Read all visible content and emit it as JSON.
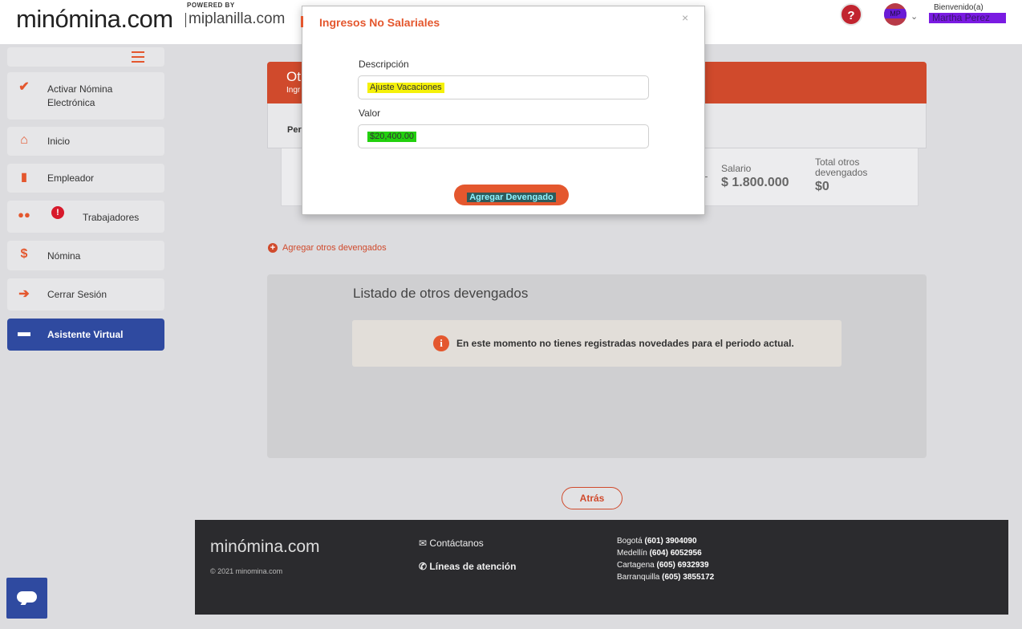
{
  "header": {
    "logo_text": "minómina.com",
    "powered_by": "POWERED BY",
    "partner": "miplanilla.com",
    "avatar_initials": "MP",
    "welcome": "Bienvenido(a)",
    "username": "Martha Perez"
  },
  "sidebar": {
    "items": [
      {
        "label": "Activar Nómina Electrónica"
      },
      {
        "label": "Inicio"
      },
      {
        "label": "Empleador"
      },
      {
        "label": "Trabajadores"
      },
      {
        "label": "Nómina"
      },
      {
        "label": "Cerrar Sesión"
      },
      {
        "label": "Asistente Virtual"
      }
    ]
  },
  "main": {
    "header_title": "Ot",
    "header_subtitle": "Ingr",
    "period_label": "Per",
    "salary_label": "Salario",
    "salary_value": "$ 1.800.000",
    "total_label": "Total otros devengados",
    "total_value": "$0",
    "add_link": "Agregar otros devengados",
    "list_title": "Listado de otros devengados",
    "notice": "En este momento no tienes registradas novedades para el periodo actual.",
    "back_button": "Atrás"
  },
  "footer": {
    "logo_text": "minómina.com",
    "copyright": "© 2021 minomina.com",
    "contact": "Contáctanos",
    "lines": "Líneas de atención",
    "cities": [
      {
        "city": "Bogotá",
        "phone": "(601) 3904090"
      },
      {
        "city": "Medellín",
        "phone": "(604) 6052956"
      },
      {
        "city": "Cartagena",
        "phone": "(605) 6932939"
      },
      {
        "city": "Barranquilla",
        "phone": "(605) 3855172"
      }
    ]
  },
  "modal": {
    "title": "Ingresos No Salariales",
    "close": "×",
    "description_label": "Descripción",
    "description_value": "Ajuste Vacaciones",
    "value_label": "Valor",
    "value_value": "$20,400.00",
    "submit": "Agregar Devengado"
  },
  "colors": {
    "accent": "#e4572e",
    "header_orange": "#d04a2c",
    "primary_blue": "#2f4aa0",
    "footer_bg": "#2b2b2e"
  },
  "icons": [
    "check-icon",
    "home-icon",
    "building-icon",
    "users-icon",
    "dollar-icon",
    "logout-icon",
    "chat-icon",
    "help-icon",
    "info-icon",
    "plus-circle-icon",
    "mail-icon",
    "phone-icon",
    "close-icon",
    "chevron-down-icon",
    "menu-icon"
  ]
}
